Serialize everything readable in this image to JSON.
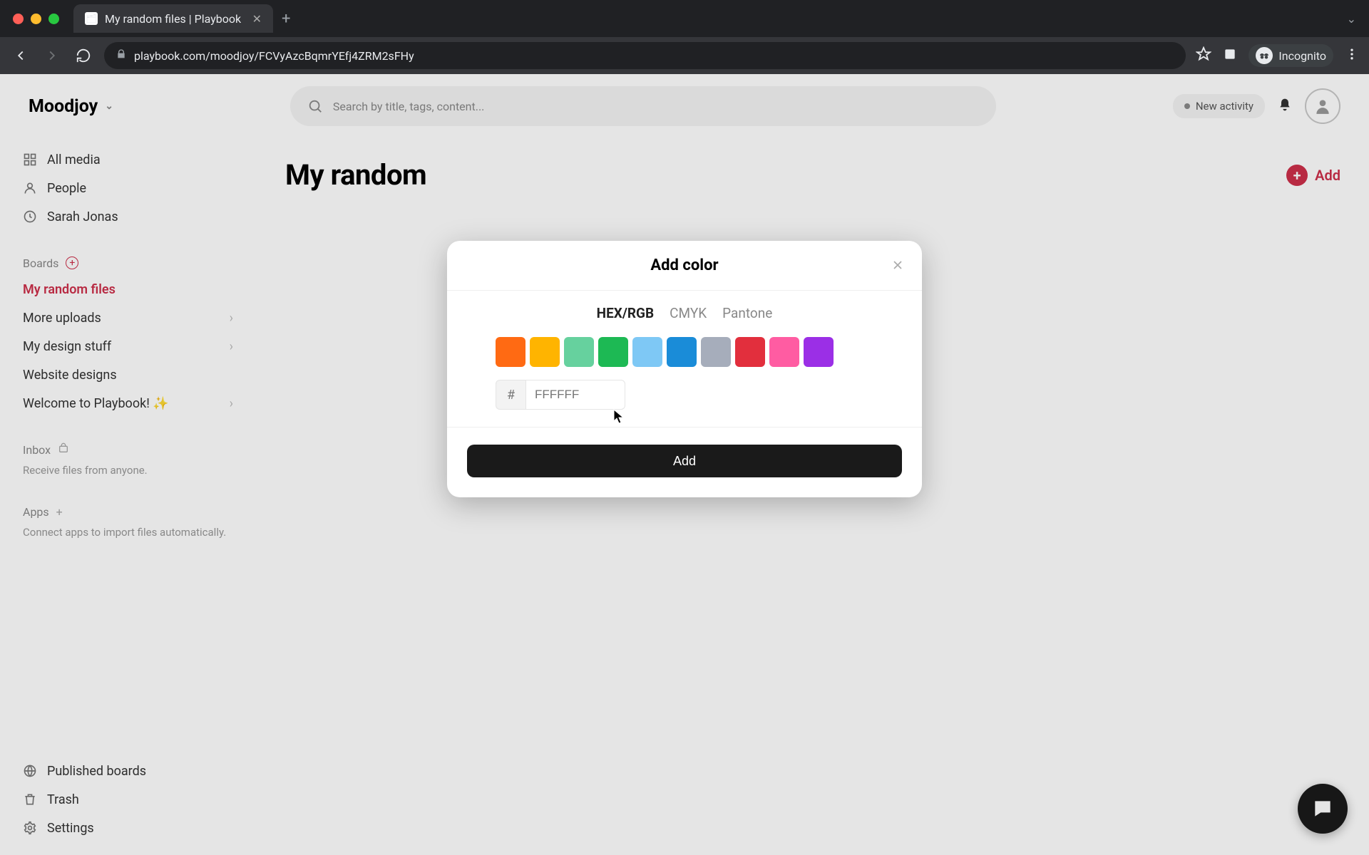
{
  "browser": {
    "tab_title": "My random files | Playbook",
    "url": "playbook.com/moodjoy/FCVyAzcBqmrYEfj4ZRM2sFHy",
    "incognito_label": "Incognito"
  },
  "header": {
    "workspace": "Moodjoy",
    "search_placeholder": "Search by title, tags, content...",
    "new_activity": "New activity"
  },
  "sidebar": {
    "nav": [
      {
        "label": "All media",
        "icon": "grid"
      },
      {
        "label": "People",
        "icon": "person"
      },
      {
        "label": "Sarah Jonas",
        "icon": "clock"
      }
    ],
    "boards_title": "Boards",
    "boards": [
      {
        "label": "My random files",
        "active": true,
        "expand": false
      },
      {
        "label": "More uploads",
        "active": false,
        "expand": true
      },
      {
        "label": "My design stuff",
        "active": false,
        "expand": true
      },
      {
        "label": "Website designs",
        "active": false,
        "expand": false
      },
      {
        "label": "Welcome to Playbook! ✨",
        "active": false,
        "expand": true
      }
    ],
    "inbox_title": "Inbox",
    "inbox_hint": "Receive files from anyone.",
    "apps_title": "Apps",
    "apps_hint": "Connect apps to import files automatically.",
    "bottom": [
      {
        "label": "Published boards",
        "icon": "globe"
      },
      {
        "label": "Trash",
        "icon": "trash"
      },
      {
        "label": "Settings",
        "icon": "gear"
      }
    ]
  },
  "main": {
    "title": "My random",
    "add_label": "Add"
  },
  "modal": {
    "title": "Add color",
    "tabs": [
      {
        "label": "HEX/RGB",
        "active": true
      },
      {
        "label": "CMYK",
        "active": false
      },
      {
        "label": "Pantone",
        "active": false
      }
    ],
    "swatches": [
      "#ff6a13",
      "#ffb400",
      "#66d19e",
      "#1db954",
      "#7ec8f5",
      "#1a8cd8",
      "#a6adbb",
      "#e22f3d",
      "#ff5ca2",
      "#9b2fe6"
    ],
    "hash": "#",
    "hex_placeholder": "FFFFFF",
    "add_button": "Add"
  }
}
